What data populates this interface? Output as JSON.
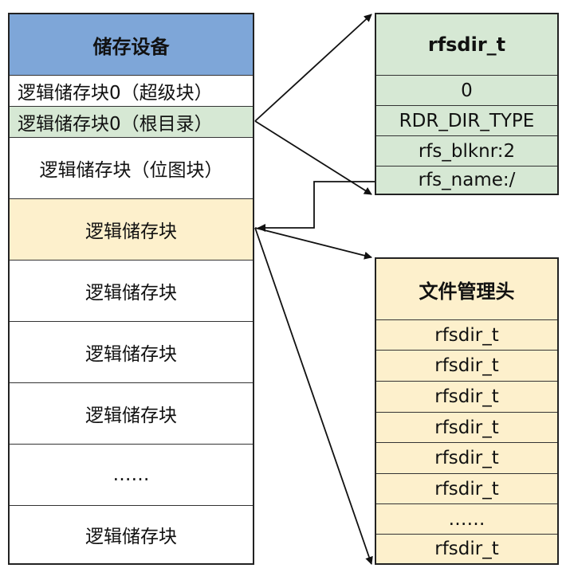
{
  "left_stack": {
    "header": "储存设备",
    "cells": [
      {
        "label": "逻辑储存块0（超级块）",
        "align": "left"
      },
      {
        "label": "逻辑储存块0（根目录）",
        "align": "left"
      },
      {
        "label": "逻辑储存块（位图块）",
        "align": "center"
      },
      {
        "label": "逻辑储存块",
        "align": "center"
      },
      {
        "label": "逻辑储存块",
        "align": "center"
      },
      {
        "label": "逻辑储存块",
        "align": "center"
      },
      {
        "label": "逻辑储存块",
        "align": "center"
      },
      {
        "label": "……",
        "align": "center"
      },
      {
        "label": "逻辑储存块",
        "align": "center"
      }
    ]
  },
  "rfsdir_box": {
    "header": "rfsdir_t",
    "fields": [
      "0",
      "RDR_DIR_TYPE",
      "rfs_blknr:2",
      "rfs_name:/"
    ]
  },
  "file_header_box": {
    "header": "文件管理头",
    "rows": [
      "rfsdir_t",
      "rfsdir_t",
      "rfsdir_t",
      "rfsdir_t",
      "rfsdir_t",
      "rfsdir_t",
      "……",
      "rfsdir_t"
    ]
  },
  "colors": {
    "header_blue": "#7ea6d8",
    "green": "#d6e8d4",
    "yellow": "#fdf0cc",
    "border": "#222222"
  }
}
